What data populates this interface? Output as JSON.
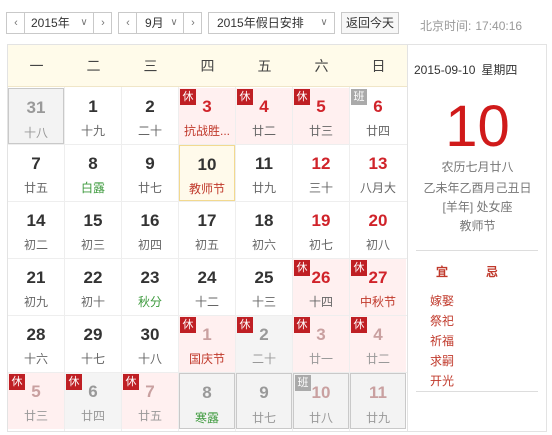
{
  "toolbar": {
    "year": "2015年",
    "month": "9月",
    "holiday": "2015年假日安排",
    "today_button": "返回今天",
    "clock_label": "北京时间:",
    "clock_time": "17:40:16"
  },
  "weekdays": [
    "一",
    "二",
    "三",
    "四",
    "五",
    "六",
    "日"
  ],
  "weeks": [
    [
      {
        "n": "31",
        "l": "十八",
        "cls": "other sel"
      },
      {
        "n": "1",
        "l": "十九",
        "cls": ""
      },
      {
        "n": "2",
        "l": "二十",
        "cls": ""
      },
      {
        "n": "3",
        "l": "抗战胜...",
        "cls": "red fest rest",
        "tag": "休"
      },
      {
        "n": "4",
        "l": "廿二",
        "cls": "red rest",
        "tag": "休"
      },
      {
        "n": "5",
        "l": "廿三",
        "cls": "red rest",
        "tag": "休"
      },
      {
        "n": "6",
        "l": "廿四",
        "cls": "red",
        "tag": "班",
        "ban": true
      }
    ],
    [
      {
        "n": "7",
        "l": "廿五",
        "cls": ""
      },
      {
        "n": "8",
        "l": "白露",
        "cls": "term"
      },
      {
        "n": "9",
        "l": "廿七",
        "cls": ""
      },
      {
        "n": "10",
        "l": "教师节",
        "cls": "today fest"
      },
      {
        "n": "11",
        "l": "廿九",
        "cls": ""
      },
      {
        "n": "12",
        "l": "三十",
        "cls": "red"
      },
      {
        "n": "13",
        "l": "八月大",
        "cls": "red"
      }
    ],
    [
      {
        "n": "14",
        "l": "初二",
        "cls": ""
      },
      {
        "n": "15",
        "l": "初三",
        "cls": ""
      },
      {
        "n": "16",
        "l": "初四",
        "cls": ""
      },
      {
        "n": "17",
        "l": "初五",
        "cls": ""
      },
      {
        "n": "18",
        "l": "初六",
        "cls": ""
      },
      {
        "n": "19",
        "l": "初七",
        "cls": "red"
      },
      {
        "n": "20",
        "l": "初八",
        "cls": "red"
      }
    ],
    [
      {
        "n": "21",
        "l": "初九",
        "cls": ""
      },
      {
        "n": "22",
        "l": "初十",
        "cls": ""
      },
      {
        "n": "23",
        "l": "秋分",
        "cls": "term"
      },
      {
        "n": "24",
        "l": "十二",
        "cls": ""
      },
      {
        "n": "25",
        "l": "十三",
        "cls": ""
      },
      {
        "n": "26",
        "l": "十四",
        "cls": "red rest",
        "tag": "休"
      },
      {
        "n": "27",
        "l": "中秋节",
        "cls": "red fest rest",
        "tag": "休"
      }
    ],
    [
      {
        "n": "28",
        "l": "十六",
        "cls": ""
      },
      {
        "n": "29",
        "l": "十七",
        "cls": ""
      },
      {
        "n": "30",
        "l": "十八",
        "cls": ""
      },
      {
        "n": "1",
        "l": "国庆节",
        "cls": "other fest rest faint",
        "tag": "休"
      },
      {
        "n": "2",
        "l": "二十",
        "cls": "other restgray",
        "tag": "休"
      },
      {
        "n": "3",
        "l": "廿一",
        "cls": "other rest faint",
        "tag": "休"
      },
      {
        "n": "4",
        "l": "廿二",
        "cls": "other rest faint",
        "tag": "休"
      }
    ],
    [
      {
        "n": "5",
        "l": "廿三",
        "cls": "other rest faint",
        "tag": "休"
      },
      {
        "n": "6",
        "l": "廿四",
        "cls": "other restgray",
        "tag": "休"
      },
      {
        "n": "7",
        "l": "廿五",
        "cls": "other rest faint",
        "tag": "休"
      },
      {
        "n": "8",
        "l": "寒露",
        "cls": "other term sel"
      },
      {
        "n": "9",
        "l": "廿七",
        "cls": "other sel"
      },
      {
        "n": "10",
        "l": "廿八",
        "cls": "other sel faint",
        "tag": "班",
        "ban": true
      },
      {
        "n": "11",
        "l": "廿九",
        "cls": "other sel faint"
      }
    ]
  ],
  "panel": {
    "date": "2015-09-10",
    "weekday": "星期四",
    "day": "10",
    "lunar": "农历七月廿八",
    "ganzhi": "乙未年乙酉月己丑日",
    "zodiac": "[羊年] 处女座",
    "festival": "教师节",
    "yi_label": "宜",
    "ji_label": "忌",
    "yi_items": [
      "嫁娶",
      "祭祀",
      "祈福",
      "求嗣",
      "开光"
    ]
  },
  "colors": {
    "accent": "#d01a1a",
    "rest_tag": "#bf1f24",
    "work_tag": "#aaaaaa"
  }
}
